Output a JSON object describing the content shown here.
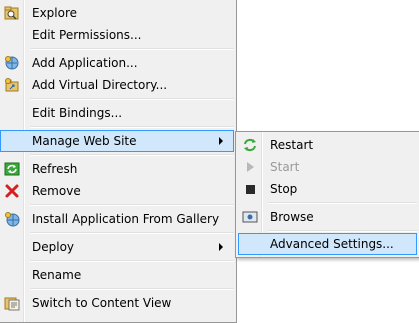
{
  "main_menu": {
    "items": [
      {
        "label": "Explore",
        "icon": "folder-search-icon"
      },
      {
        "label": "Edit Permissions...",
        "icon": ""
      },
      {
        "label": "Add Application...",
        "icon": "add-application-icon"
      },
      {
        "label": "Add Virtual Directory...",
        "icon": "add-virtual-directory-icon"
      },
      {
        "label": "Edit Bindings...",
        "icon": ""
      },
      {
        "label": "Manage Web Site",
        "icon": ""
      },
      {
        "label": "Refresh",
        "icon": "refresh-icon"
      },
      {
        "label": "Remove",
        "icon": "remove-icon"
      },
      {
        "label": "Install Application From Gallery",
        "icon": "gallery-icon"
      },
      {
        "label": "Deploy",
        "icon": ""
      },
      {
        "label": "Rename",
        "icon": ""
      },
      {
        "label": "Switch to Content View",
        "icon": "content-view-icon"
      }
    ]
  },
  "submenu": {
    "items": [
      {
        "label": "Restart",
        "icon": "restart-icon"
      },
      {
        "label": "Start",
        "icon": "start-icon"
      },
      {
        "label": "Stop",
        "icon": "stop-icon"
      },
      {
        "label": "Browse",
        "icon": "browse-icon"
      },
      {
        "label": "Advanced Settings...",
        "icon": ""
      }
    ]
  },
  "colors": {
    "menu_bg": "#f0f0f0",
    "highlight_bg": "#d1e7fb",
    "highlight_border": "#3399ff",
    "disabled_text": "#9a9a9a"
  }
}
